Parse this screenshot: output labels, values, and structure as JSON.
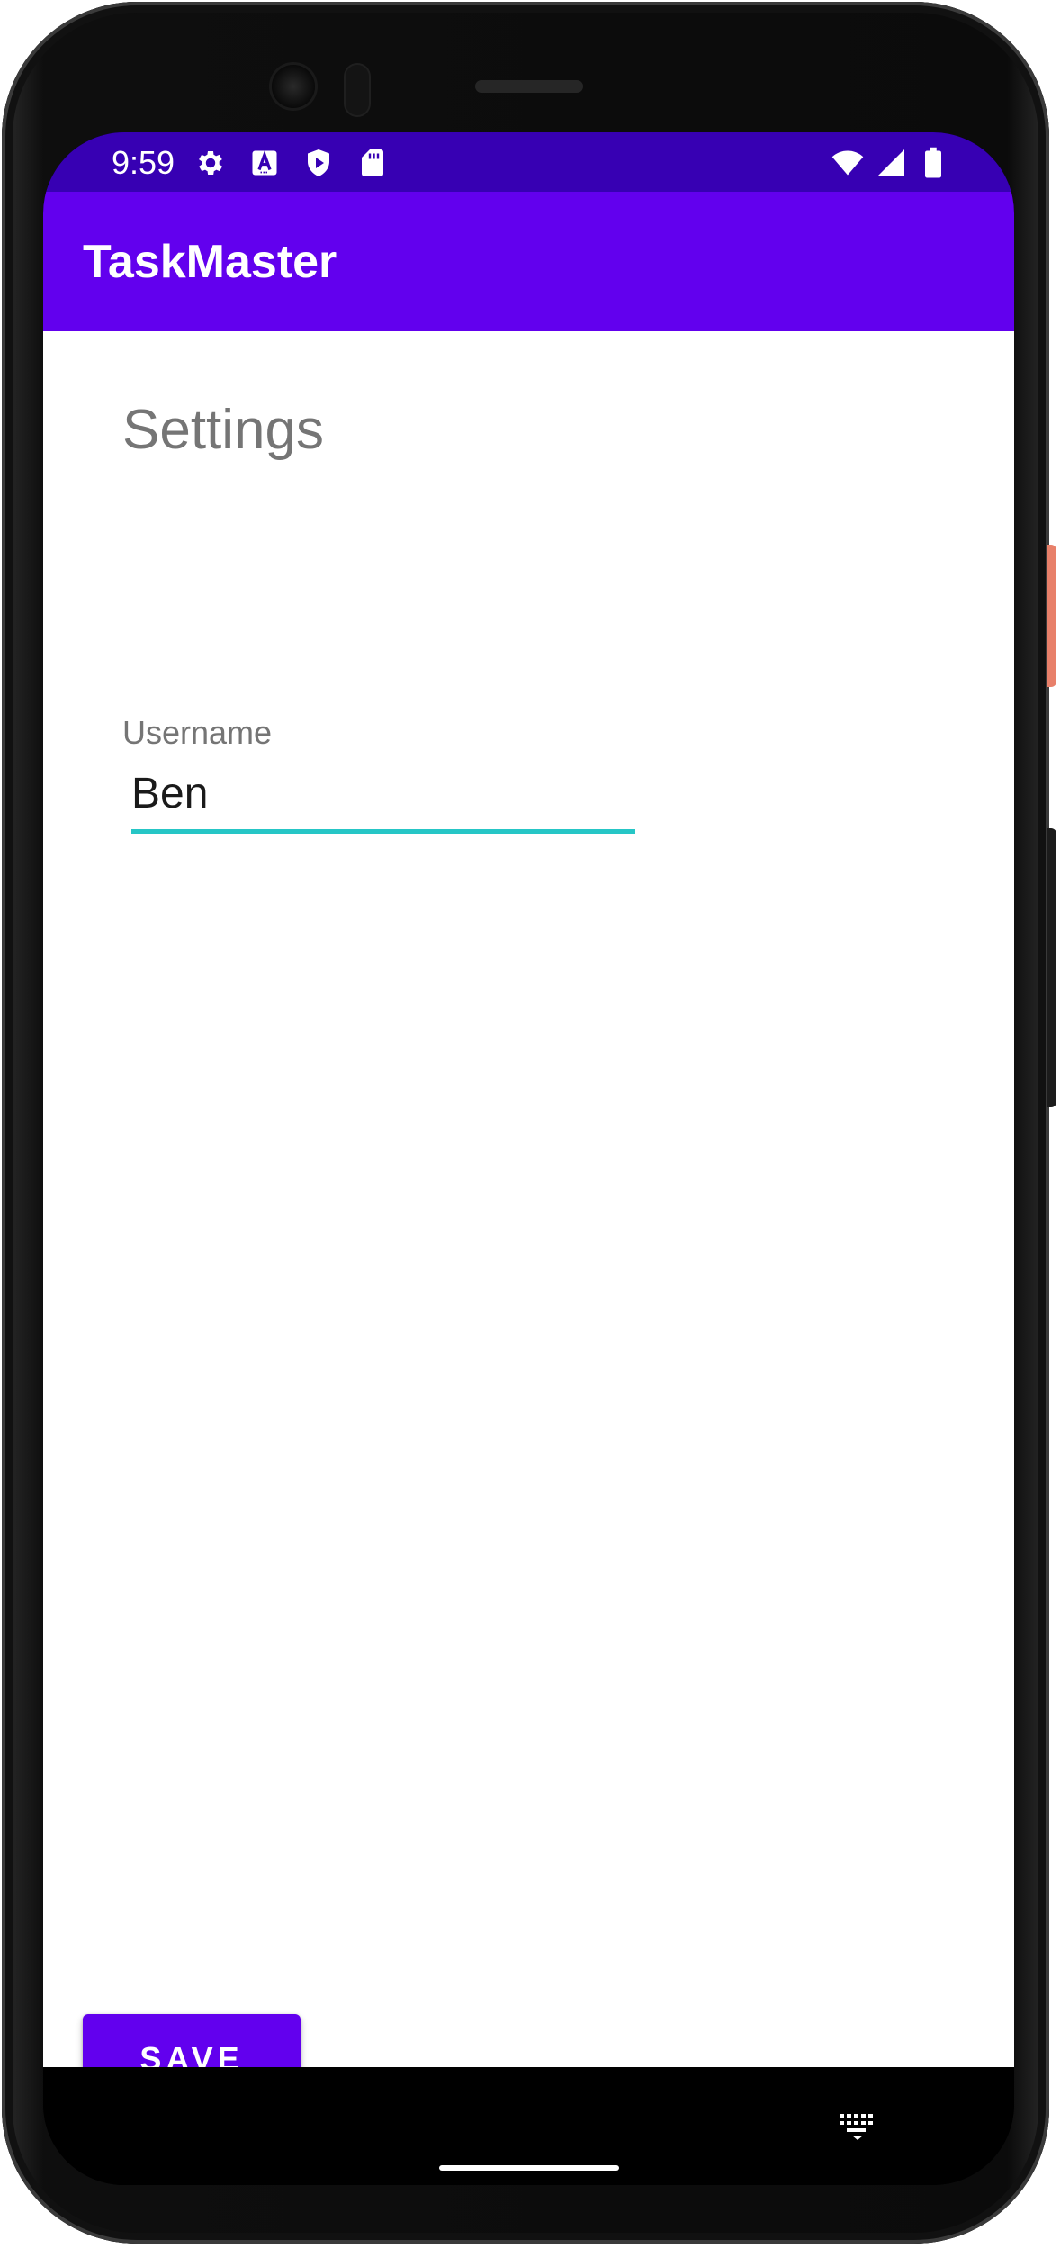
{
  "status_bar": {
    "time": "9:59",
    "left_icons": [
      "gear-icon",
      "text-a-icon",
      "play-shield-icon",
      "sd-card-icon"
    ],
    "right_icons": [
      "wifi-icon",
      "cellular-signal-icon",
      "battery-icon"
    ]
  },
  "app_bar": {
    "title": "TaskMaster"
  },
  "settings": {
    "heading": "Settings",
    "username_label": "Username",
    "username_value": "Ben"
  },
  "actions": {
    "save_label": "SAVE"
  },
  "nav_bar": {
    "icons": [
      "keyboard-icon",
      "home-handle"
    ]
  },
  "colors": {
    "status_bar": "#3700b3",
    "primary": "#6200ee",
    "accent_underline": "#26c6c6",
    "secondary_text": "#757575"
  }
}
